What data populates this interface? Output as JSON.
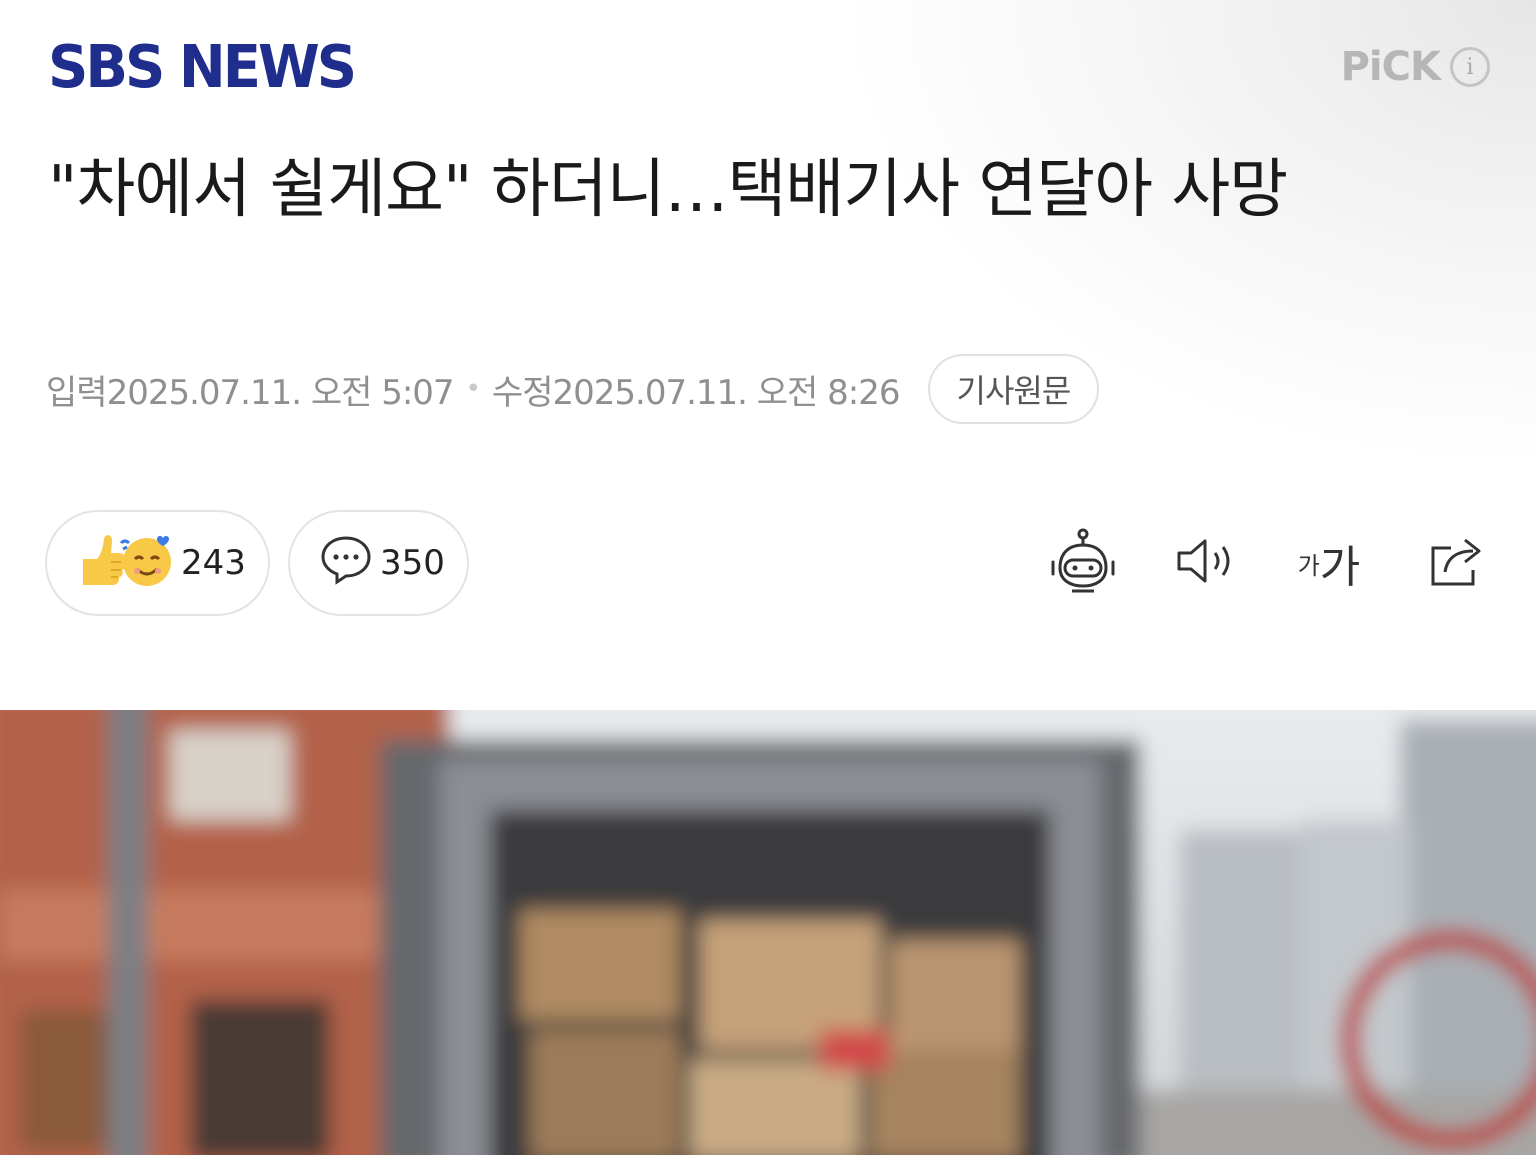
{
  "header": {
    "logo": "SBS NEWS",
    "pick_label": "PiCK",
    "info_icon": "i"
  },
  "article": {
    "title": "\"차에서 쉴게요\" 하더니…택배기사 연달아 사망",
    "input_label": "입력",
    "input_time": "2025.07.11. 오전 5:07",
    "separator": "•",
    "modified_label": "수정",
    "modified_time": "2025.07.11. 오전 8:26",
    "original_link": "기사원문"
  },
  "actions": {
    "reaction_count": "243",
    "comment_count": "350"
  },
  "tools": {
    "summary_icon": "robot-icon",
    "tts_icon": "speaker-icon",
    "font_small": "가",
    "font_big": "가",
    "share_icon": "share-icon"
  },
  "photo": {
    "description_icon": "delivery-truck-photo"
  },
  "colors": {
    "logo_blue": "#1f2e8c",
    "meta_gray": "#8f8f8f",
    "pick_gray": "#b6b6b6",
    "emoji_yellow": "#f8c847",
    "truck_frame": "#6e7076"
  }
}
